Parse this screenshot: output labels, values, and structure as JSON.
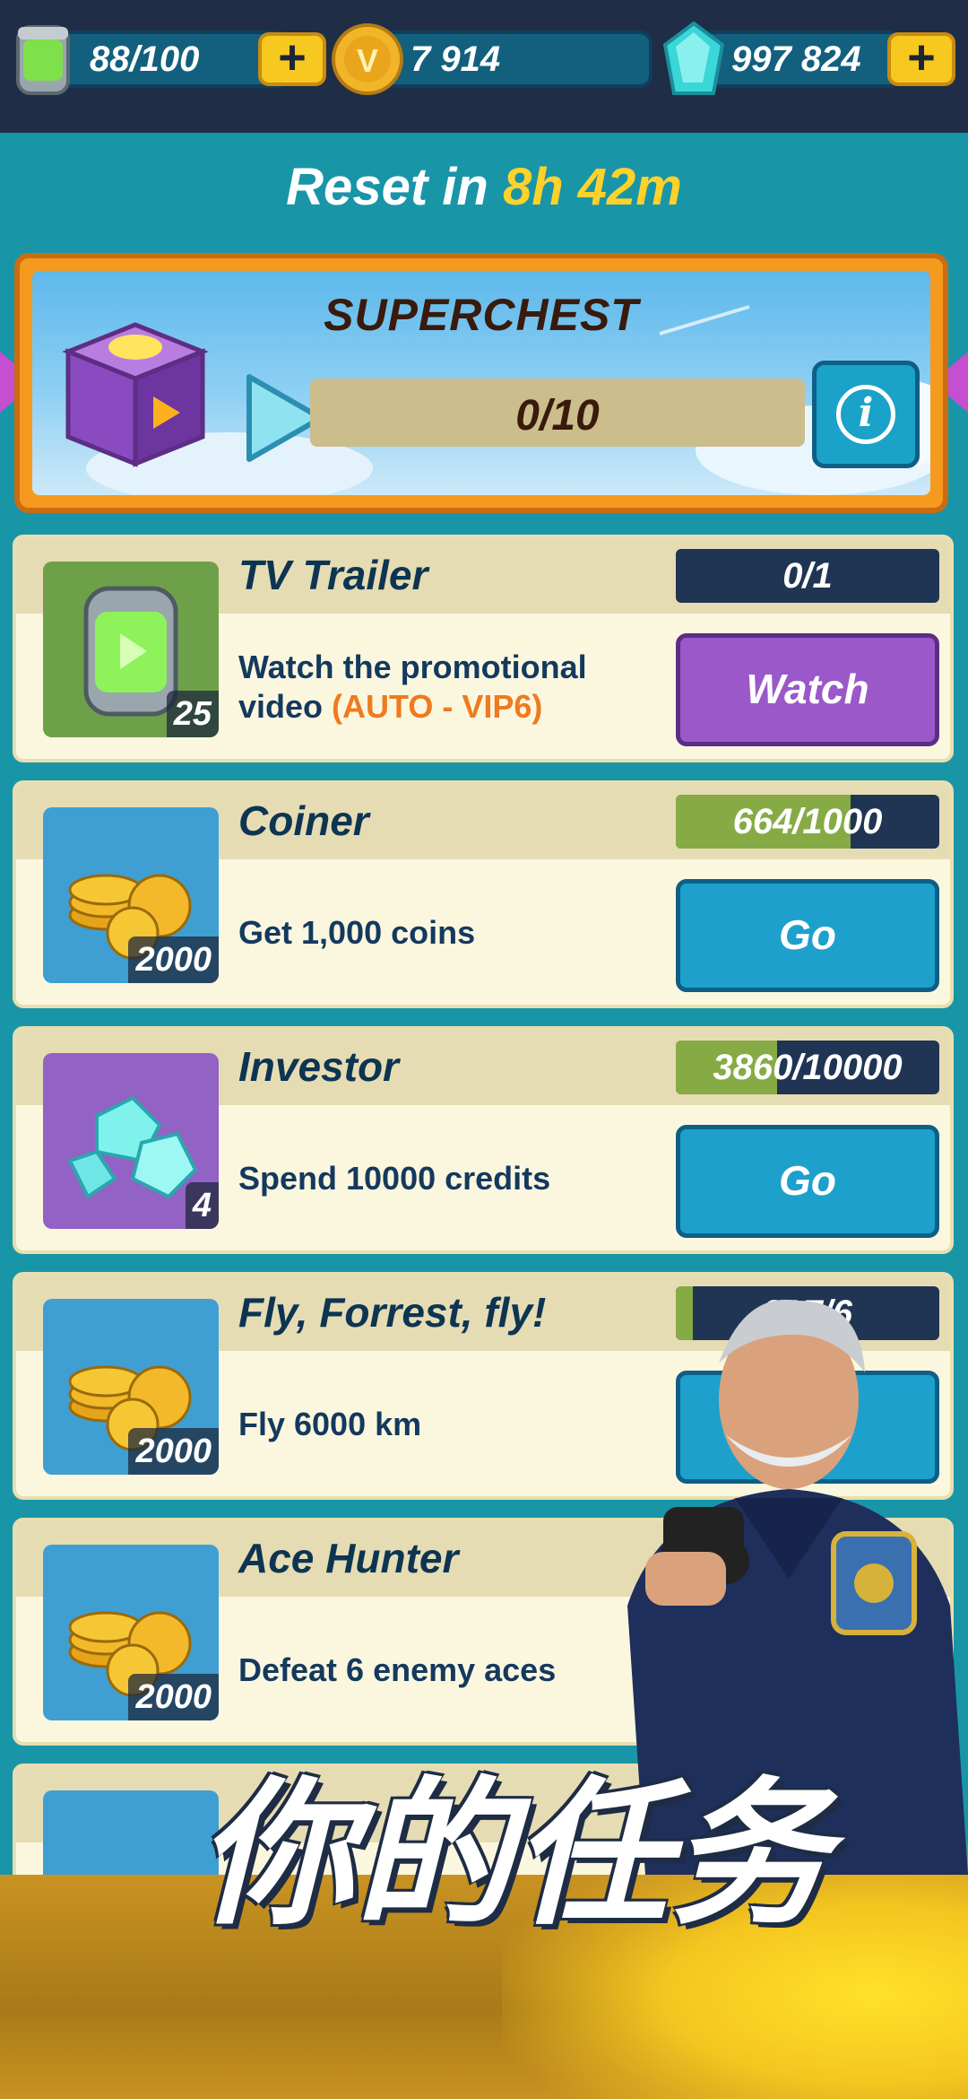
{
  "resources": {
    "energy": {
      "value": "88/100",
      "icon": "energy-canister-icon"
    },
    "coins": {
      "value": "7 914",
      "icon": "coin-icon"
    },
    "gems": {
      "value": "997 824",
      "icon": "gem-icon"
    }
  },
  "reset": {
    "label": "Reset in",
    "time": "8h 42m"
  },
  "superchest": {
    "title": "SUPERCHEST",
    "progress": "0/10",
    "progress_fraction": 0,
    "info_label": "i"
  },
  "missions": [
    {
      "title": "TV Trailer",
      "desc": "Watch the promotional video",
      "desc_highlight": "(AUTO - VIP6)",
      "reward_qty": "25",
      "progress_text": "0/1",
      "progress_fraction": 0,
      "action": "Watch",
      "icon": "energy-canister-icon"
    },
    {
      "title": "Coiner",
      "desc": "Get 1,000 coins",
      "reward_qty": "2000",
      "progress_text": "664/1000",
      "progress_fraction": 0.664,
      "action": "Go",
      "icon": "coin-pile-icon"
    },
    {
      "title": "Investor",
      "desc": "Spend 10000 credits",
      "reward_qty": "4",
      "progress_text": "3860/10000",
      "progress_fraction": 0.386,
      "action": "Go",
      "icon": "gem-pile-icon"
    },
    {
      "title": "Fly, Forrest, fly!",
      "desc": "Fly 6000 km",
      "reward_qty": "2000",
      "progress_text": "397/6",
      "progress_fraction": 0.066,
      "action": "G",
      "icon": "coin-pile-icon"
    },
    {
      "title": "Ace Hunter",
      "desc": "Defeat 6 enemy aces",
      "reward_qty": "2000",
      "icon": "coin-pile-icon"
    }
  ],
  "headline": "你的任务",
  "colors": {
    "accent_yellow": "#ffd22b",
    "panel": "#fbf7df",
    "bg": "#1995a8",
    "progress_fill": "#86ab45",
    "progress_bg": "#1f3553"
  }
}
